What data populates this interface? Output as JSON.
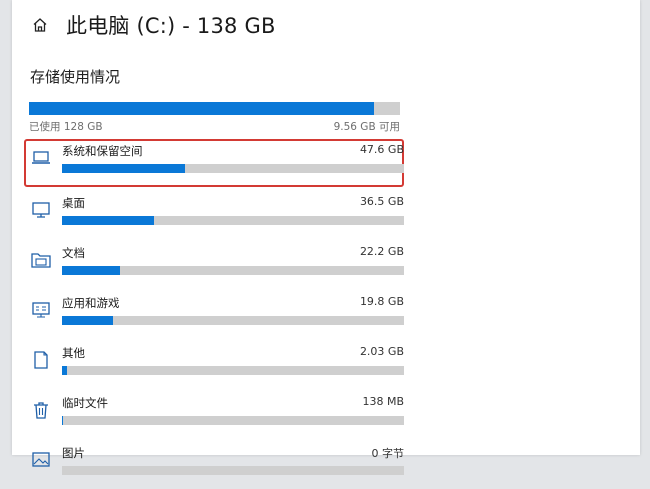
{
  "header": {
    "title": "此电脑 (C:) - 138 GB"
  },
  "storage": {
    "section_title": "存储使用情况",
    "used_label": "已使用 128 GB",
    "free_label": "9.56 GB 可用",
    "used_fraction": 0.93
  },
  "categories": [
    {
      "name": "系统和保留空间",
      "size": "47.6 GB",
      "fraction": 0.36,
      "icon": "laptop-icon"
    },
    {
      "name": "桌面",
      "size": "36.5 GB",
      "fraction": 0.27,
      "icon": "monitor-icon"
    },
    {
      "name": "文档",
      "size": "22.2 GB",
      "fraction": 0.17,
      "icon": "documents-folder-icon"
    },
    {
      "name": "应用和游戏",
      "size": "19.8 GB",
      "fraction": 0.15,
      "icon": "apps-icon"
    },
    {
      "name": "其他",
      "size": "2.03 GB",
      "fraction": 0.015,
      "icon": "other-icon"
    },
    {
      "name": "临时文件",
      "size": "138 MB",
      "fraction": 0.002,
      "icon": "trash-icon"
    },
    {
      "name": "图片",
      "size": "0 字节",
      "fraction": 0,
      "icon": "pictures-icon"
    }
  ],
  "colors": {
    "accent": "#0a78d7",
    "track": "#cfcfcf",
    "highlight_border": "#d33a34"
  }
}
